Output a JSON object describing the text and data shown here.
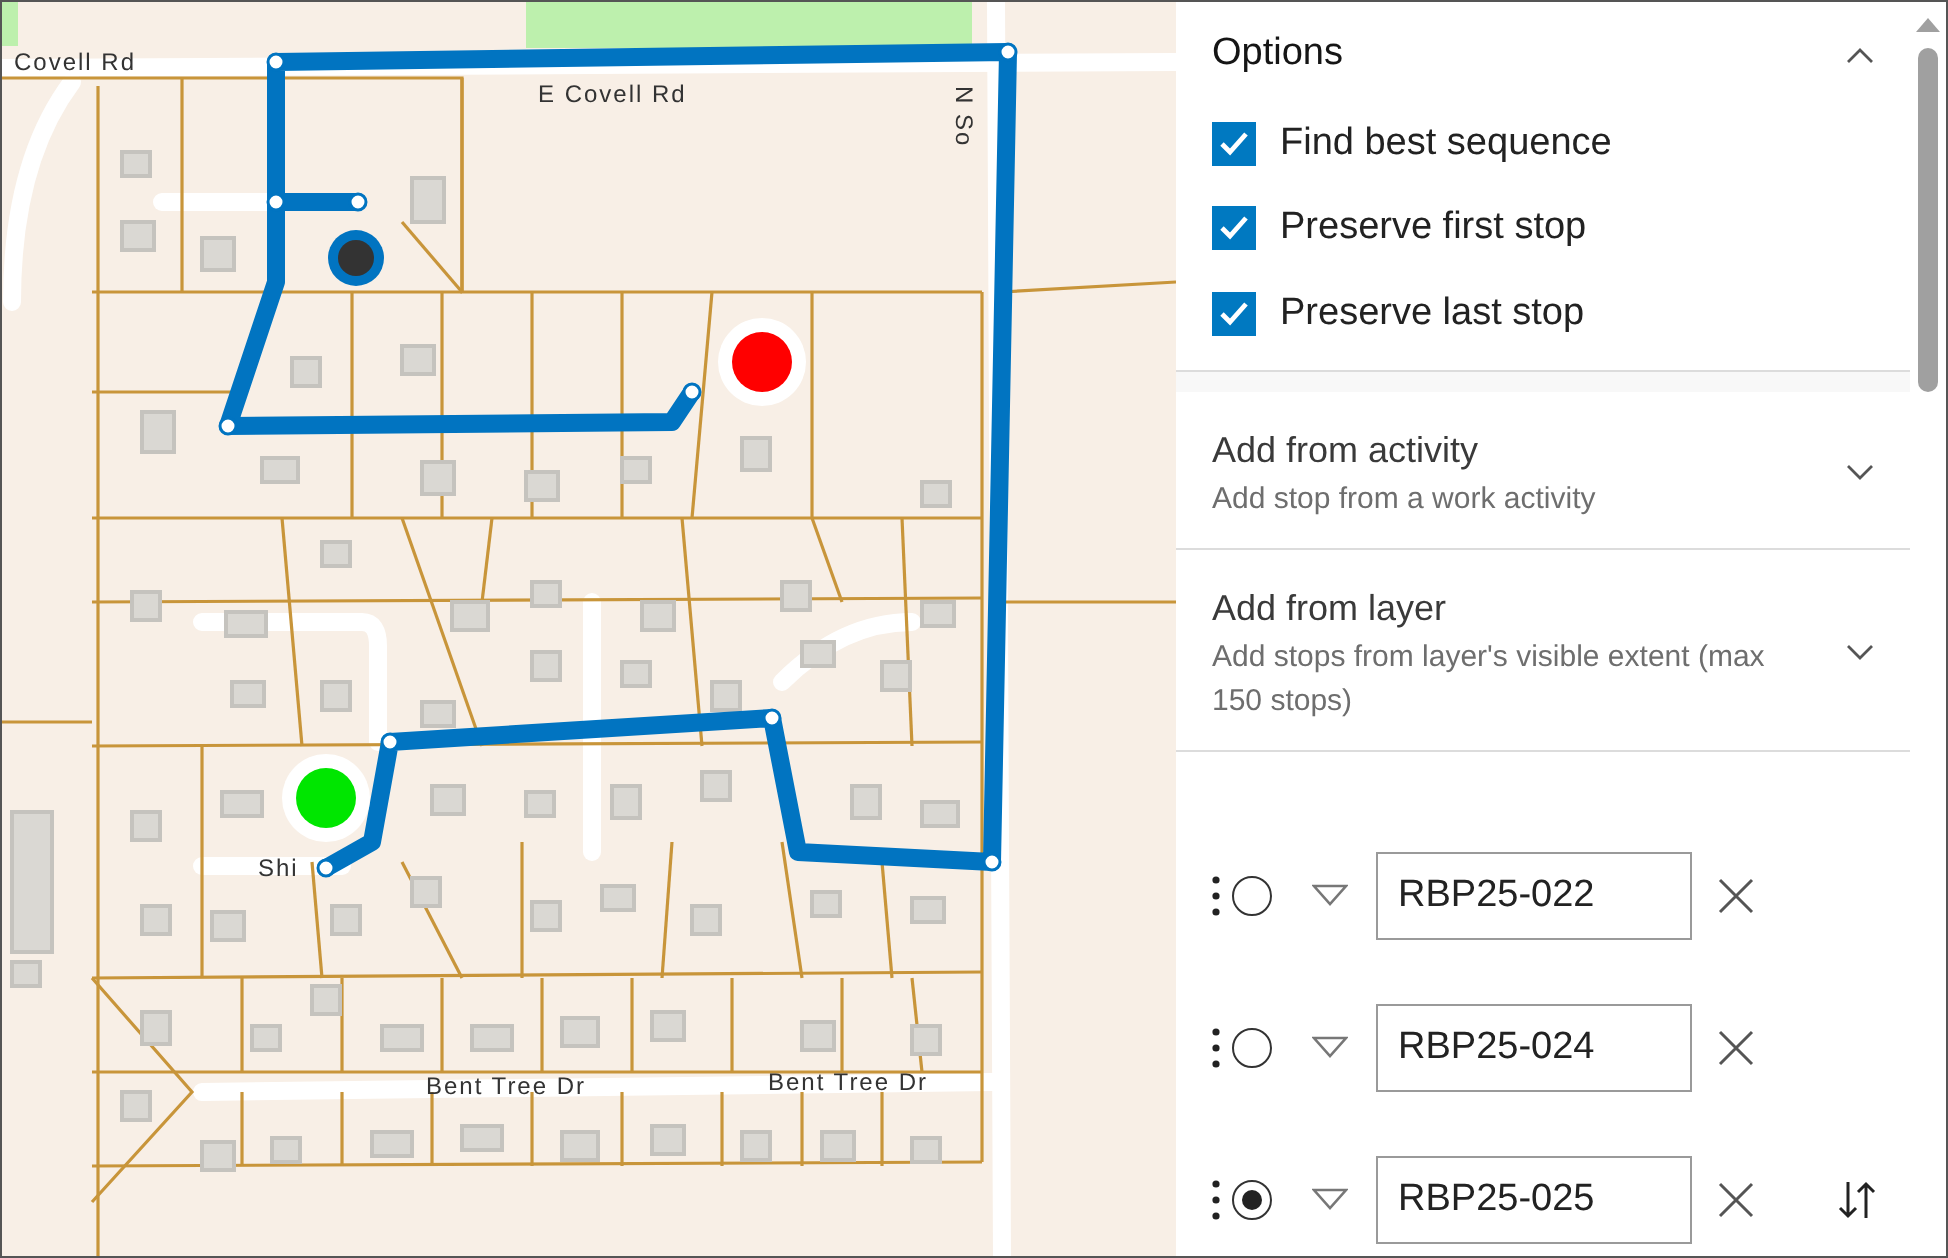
{
  "map": {
    "street_labels": [
      {
        "text": "Covell Rd",
        "kind": "horizontal"
      },
      {
        "text": "E Covell Rd",
        "kind": "horizontal"
      },
      {
        "text": "N So",
        "kind": "vertical"
      },
      {
        "text": "Shi",
        "kind": "horizontal"
      },
      {
        "text": "Bent Tree Dr",
        "kind": "horizontal"
      },
      {
        "text": "Bent Tree Dr",
        "kind": "horizontal"
      }
    ]
  },
  "options": {
    "title": "Options",
    "expanded": true,
    "checkboxes": [
      {
        "label": "Find best sequence",
        "checked": true
      },
      {
        "label": "Preserve first stop",
        "checked": true
      },
      {
        "label": "Preserve last stop",
        "checked": true
      }
    ]
  },
  "sections": [
    {
      "title": "Add from activity",
      "subtitle": "Add stop from a work activity",
      "expanded": false
    },
    {
      "title": "Add from layer",
      "subtitle": "Add stops from layer's visible extent (max 150 stops)",
      "expanded": false
    }
  ],
  "stops": [
    {
      "value": "RBP25-022",
      "selected": false
    },
    {
      "value": "RBP25-024",
      "selected": false
    },
    {
      "value": "RBP25-025",
      "selected": true
    }
  ]
}
